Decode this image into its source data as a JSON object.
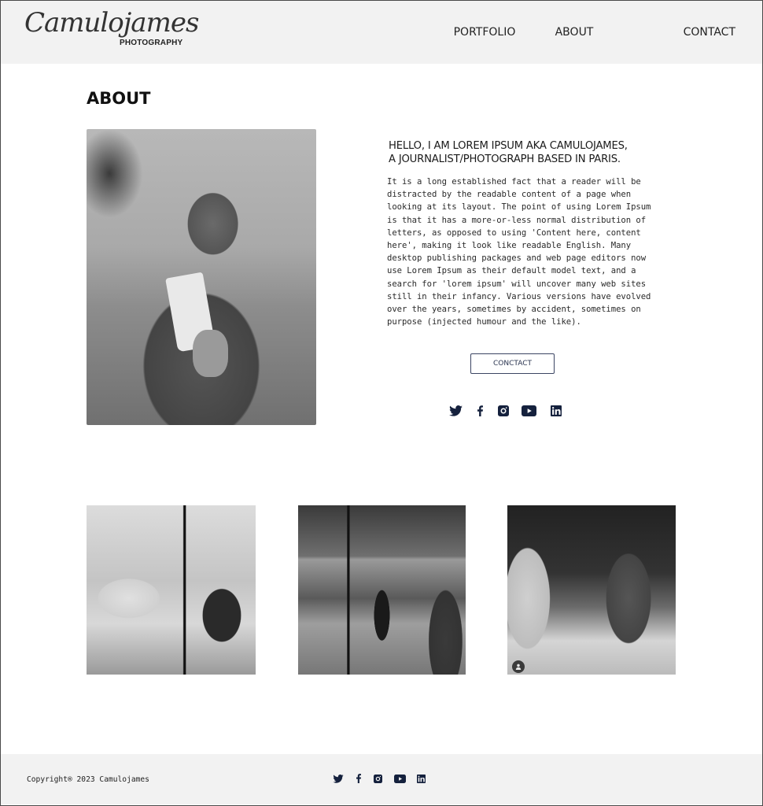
{
  "header": {
    "logo_script": "Camulojames",
    "logo_sub": "PHOTOGRAPHY",
    "nav": [
      {
        "label": "PORTFOLIO"
      },
      {
        "label": "ABOUT"
      },
      {
        "label": "CONTACT"
      }
    ]
  },
  "about": {
    "title": "ABOUT",
    "portrait_alt": "Black and white portrait of a man drinking from a cup",
    "heading_line1": "HELLO, I AM LOREM IPSUM AKA CAMULOJAMES,",
    "heading_line2": "A JOURNALIST/PHOTOGRAPH BASED IN PARIS.",
    "body": "It is a long established fact that a reader will be\ndistracted by the readable content of a page when\nlooking at its layout. The point of using Lorem Ipsum\nis that it has a more-or-less normal distribution of\nletters, as opposed to using 'Content here, content\nhere', making it look like readable English. Many\ndesktop publishing packages and web page editors now\nuse Lorem Ipsum as their default model text, and a\nsearch for 'lorem ipsum' will uncover many web sites\nstill in their infancy. Various versions have evolved\nover the years, sometimes by accident, sometimes on\npurpose (injected humour and the like).",
    "contact_button": "CONCTACT"
  },
  "social": {
    "icons": [
      "twitter-icon",
      "facebook-icon",
      "instagram-icon",
      "youtube-icon",
      "linkedin-icon"
    ],
    "color": "#15213d"
  },
  "gallery": [
    {
      "alt": "Photo shoot in a living room with a man on a sofa"
    },
    {
      "alt": "Photo shoot in a courtyard with a light stand"
    },
    {
      "alt": "Photographer shooting a man in a hoodie sitting on a piano"
    }
  ],
  "footer": {
    "copyright": "Copyright® 2023 Camulojames"
  }
}
